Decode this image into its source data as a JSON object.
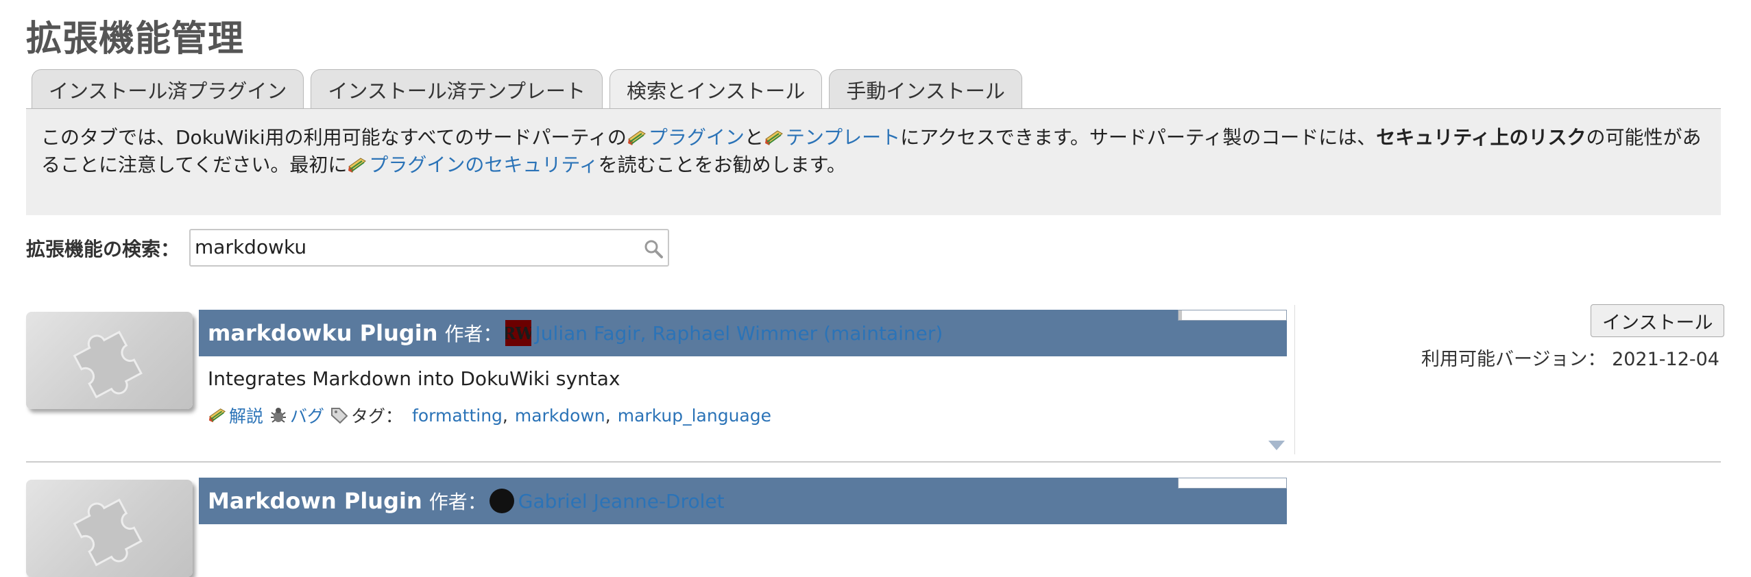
{
  "page_title": "拡張機能管理",
  "tabs": [
    {
      "label": "インストール済プラグイン",
      "active": false
    },
    {
      "label": "インストール済テンプレート",
      "active": false
    },
    {
      "label": "検索とインストール",
      "active": true
    },
    {
      "label": "手動インストール",
      "active": false
    }
  ],
  "intro": {
    "t1": "このタブでは、DokuWiki用の利用可能なすべてのサードパーティの",
    "link_plugins": "プラグイン",
    "t2": "と",
    "link_templates": "テンプレート",
    "t3": "にアクセスできます。サードパーティ製のコードには、",
    "bold_risk": "セキュリティ上のリスク",
    "t4": "の可能性があることに注意してください。最初に",
    "link_security": "プラグインのセキュリティ",
    "t5": "を読むことをお勧めします。",
    "link_icon": "wiki-link-icon"
  },
  "search": {
    "label": "拡張機能の検索：",
    "value": "markdowku",
    "icon": "search-icon"
  },
  "results": [
    {
      "name": "markdowku Plugin",
      "author_label": "作者：",
      "avatar_text": "RW",
      "author": "Julian Fagir, Raphael Wimmer (maintainer)",
      "popularity": 0.03,
      "description": "Integrates Markdown into DokuWiki syntax",
      "docs_label": "解説",
      "bugs_label": "バグ",
      "tags_label": "タグ：",
      "tags": [
        "formatting",
        "markdown",
        "markup_language"
      ],
      "tag_separator": ",",
      "install_label": "インストール",
      "version_label": "利用可能バージョン：",
      "version": "2021-12-04"
    },
    {
      "name": "Markdown Plugin",
      "author_label": "作者：",
      "author": "Gabriel Jeanne-Drolet"
    }
  ],
  "colors": {
    "header_bg": "#5a7a9e",
    "link": "#2b73b7",
    "panel_bg": "#eeeeee"
  }
}
